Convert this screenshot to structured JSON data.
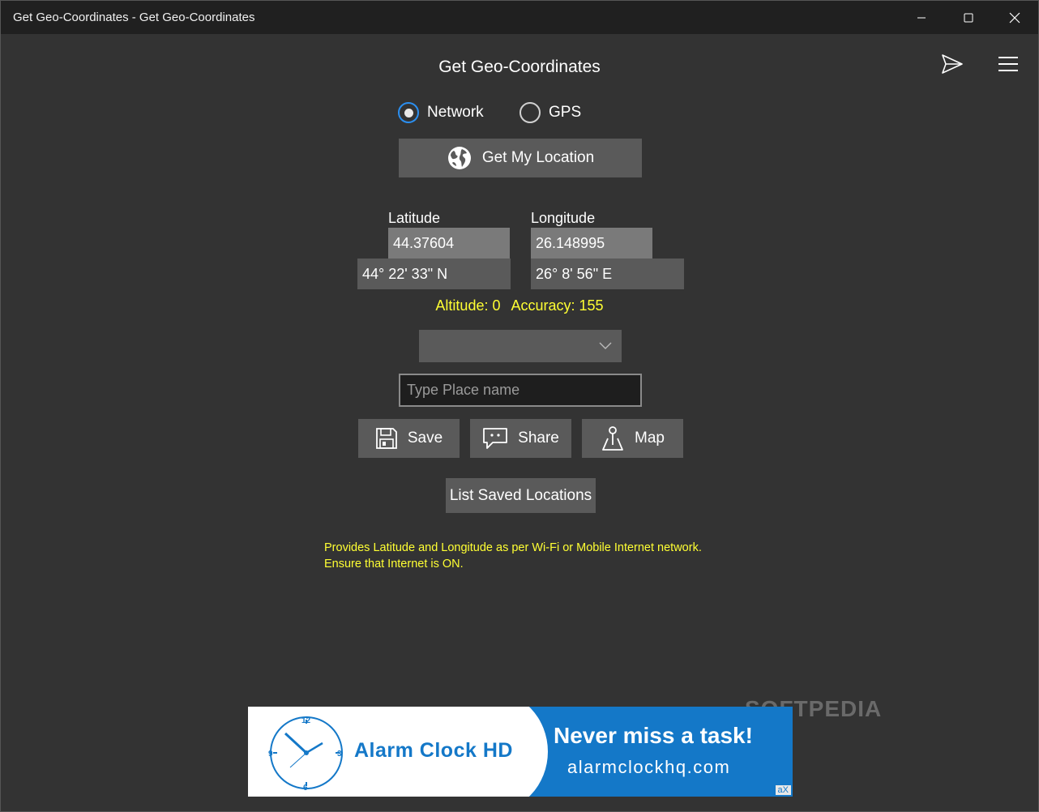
{
  "window": {
    "title": "Get Geo-Coordinates - Get Geo-Coordinates"
  },
  "app": {
    "title": "Get Geo-Coordinates",
    "radios": [
      {
        "label": "Network",
        "checked": true
      },
      {
        "label": "GPS",
        "checked": false
      }
    ],
    "get_location_label": "Get My Location",
    "latitude": {
      "label": "Latitude",
      "decimal": "44.37604",
      "dms": "44° 22' 33\" N"
    },
    "longitude": {
      "label": "Longitude",
      "decimal": "26.148995",
      "dms": "26° 8' 56\" E"
    },
    "altitude_text": "Altitude: 0",
    "accuracy_text": "Accuracy: 155",
    "dropdown_value": "",
    "place_placeholder": "Type Place name",
    "actions": {
      "save_label": "Save",
      "share_label": "Share",
      "map_label": "Map"
    },
    "list_saved_label": "List Saved Locations",
    "info_line1": "Provides Latitude and Longitude as per Wi-Fi or Mobile Internet network.",
    "info_line2": "Ensure that Internet is ON."
  },
  "ad": {
    "brand": "Alarm Clock HD",
    "headline": "Never miss a task!",
    "url": "alarmclockhq.com",
    "badge": "aX"
  },
  "watermark": "SOFTPEDIA",
  "colors": {
    "background": "#333333",
    "titlebar": "#202020",
    "button": "#5a5a5a",
    "accent_yellow": "#ffff33",
    "radio_accent": "#2b8ff0",
    "ad_blue": "#1478c8"
  }
}
